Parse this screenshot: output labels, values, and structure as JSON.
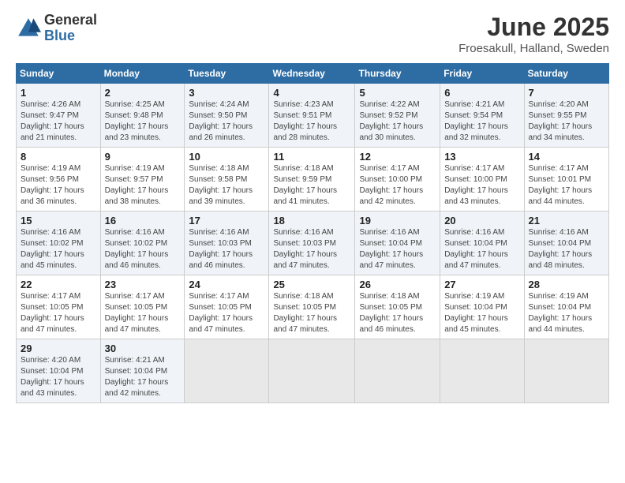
{
  "header": {
    "logo_general": "General",
    "logo_blue": "Blue",
    "month_year": "June 2025",
    "location": "Froesakull, Halland, Sweden"
  },
  "weekdays": [
    "Sunday",
    "Monday",
    "Tuesday",
    "Wednesday",
    "Thursday",
    "Friday",
    "Saturday"
  ],
  "weeks": [
    [
      {
        "day": "1",
        "info": "Sunrise: 4:26 AM\nSunset: 9:47 PM\nDaylight: 17 hours\nand 21 minutes."
      },
      {
        "day": "2",
        "info": "Sunrise: 4:25 AM\nSunset: 9:48 PM\nDaylight: 17 hours\nand 23 minutes."
      },
      {
        "day": "3",
        "info": "Sunrise: 4:24 AM\nSunset: 9:50 PM\nDaylight: 17 hours\nand 26 minutes."
      },
      {
        "day": "4",
        "info": "Sunrise: 4:23 AM\nSunset: 9:51 PM\nDaylight: 17 hours\nand 28 minutes."
      },
      {
        "day": "5",
        "info": "Sunrise: 4:22 AM\nSunset: 9:52 PM\nDaylight: 17 hours\nand 30 minutes."
      },
      {
        "day": "6",
        "info": "Sunrise: 4:21 AM\nSunset: 9:54 PM\nDaylight: 17 hours\nand 32 minutes."
      },
      {
        "day": "7",
        "info": "Sunrise: 4:20 AM\nSunset: 9:55 PM\nDaylight: 17 hours\nand 34 minutes."
      }
    ],
    [
      {
        "day": "8",
        "info": "Sunrise: 4:19 AM\nSunset: 9:56 PM\nDaylight: 17 hours\nand 36 minutes."
      },
      {
        "day": "9",
        "info": "Sunrise: 4:19 AM\nSunset: 9:57 PM\nDaylight: 17 hours\nand 38 minutes."
      },
      {
        "day": "10",
        "info": "Sunrise: 4:18 AM\nSunset: 9:58 PM\nDaylight: 17 hours\nand 39 minutes."
      },
      {
        "day": "11",
        "info": "Sunrise: 4:18 AM\nSunset: 9:59 PM\nDaylight: 17 hours\nand 41 minutes."
      },
      {
        "day": "12",
        "info": "Sunrise: 4:17 AM\nSunset: 10:00 PM\nDaylight: 17 hours\nand 42 minutes."
      },
      {
        "day": "13",
        "info": "Sunrise: 4:17 AM\nSunset: 10:00 PM\nDaylight: 17 hours\nand 43 minutes."
      },
      {
        "day": "14",
        "info": "Sunrise: 4:17 AM\nSunset: 10:01 PM\nDaylight: 17 hours\nand 44 minutes."
      }
    ],
    [
      {
        "day": "15",
        "info": "Sunrise: 4:16 AM\nSunset: 10:02 PM\nDaylight: 17 hours\nand 45 minutes."
      },
      {
        "day": "16",
        "info": "Sunrise: 4:16 AM\nSunset: 10:02 PM\nDaylight: 17 hours\nand 46 minutes."
      },
      {
        "day": "17",
        "info": "Sunrise: 4:16 AM\nSunset: 10:03 PM\nDaylight: 17 hours\nand 46 minutes."
      },
      {
        "day": "18",
        "info": "Sunrise: 4:16 AM\nSunset: 10:03 PM\nDaylight: 17 hours\nand 47 minutes."
      },
      {
        "day": "19",
        "info": "Sunrise: 4:16 AM\nSunset: 10:04 PM\nDaylight: 17 hours\nand 47 minutes."
      },
      {
        "day": "20",
        "info": "Sunrise: 4:16 AM\nSunset: 10:04 PM\nDaylight: 17 hours\nand 47 minutes."
      },
      {
        "day": "21",
        "info": "Sunrise: 4:16 AM\nSunset: 10:04 PM\nDaylight: 17 hours\nand 48 minutes."
      }
    ],
    [
      {
        "day": "22",
        "info": "Sunrise: 4:17 AM\nSunset: 10:05 PM\nDaylight: 17 hours\nand 47 minutes."
      },
      {
        "day": "23",
        "info": "Sunrise: 4:17 AM\nSunset: 10:05 PM\nDaylight: 17 hours\nand 47 minutes."
      },
      {
        "day": "24",
        "info": "Sunrise: 4:17 AM\nSunset: 10:05 PM\nDaylight: 17 hours\nand 47 minutes."
      },
      {
        "day": "25",
        "info": "Sunrise: 4:18 AM\nSunset: 10:05 PM\nDaylight: 17 hours\nand 47 minutes."
      },
      {
        "day": "26",
        "info": "Sunrise: 4:18 AM\nSunset: 10:05 PM\nDaylight: 17 hours\nand 46 minutes."
      },
      {
        "day": "27",
        "info": "Sunrise: 4:19 AM\nSunset: 10:04 PM\nDaylight: 17 hours\nand 45 minutes."
      },
      {
        "day": "28",
        "info": "Sunrise: 4:19 AM\nSunset: 10:04 PM\nDaylight: 17 hours\nand 44 minutes."
      }
    ],
    [
      {
        "day": "29",
        "info": "Sunrise: 4:20 AM\nSunset: 10:04 PM\nDaylight: 17 hours\nand 43 minutes."
      },
      {
        "day": "30",
        "info": "Sunrise: 4:21 AM\nSunset: 10:04 PM\nDaylight: 17 hours\nand 42 minutes."
      },
      {
        "day": "",
        "info": ""
      },
      {
        "day": "",
        "info": ""
      },
      {
        "day": "",
        "info": ""
      },
      {
        "day": "",
        "info": ""
      },
      {
        "day": "",
        "info": ""
      }
    ]
  ]
}
